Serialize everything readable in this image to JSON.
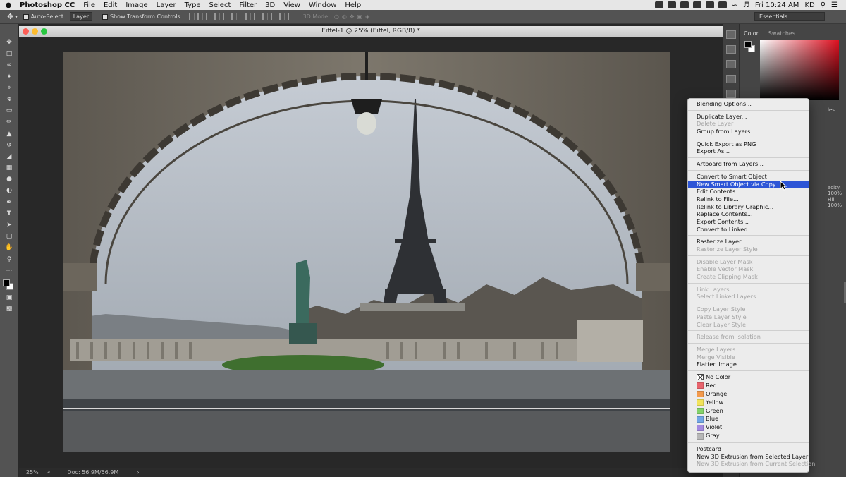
{
  "menubar": {
    "app_name": "Photoshop CC",
    "items": [
      "File",
      "Edit",
      "Image",
      "Layer",
      "Type",
      "Select",
      "Filter",
      "3D",
      "View",
      "Window",
      "Help"
    ],
    "clock": "Fri 10:24 AM",
    "user": "KD"
  },
  "options_bar": {
    "auto_select_label": "Auto-Select:",
    "auto_select_value": "Layer",
    "show_transform_label": "Show Transform Controls",
    "mode_3d_label": "3D Mode:",
    "workspace": "Essentials"
  },
  "document": {
    "title": "Eiffel-1 @ 25% (Eiffel, RGB/8) *"
  },
  "status_bar": {
    "zoom": "25%",
    "doc_size": "Doc: 56.9M/56.9M"
  },
  "panels": {
    "color_tab": "Color",
    "swatches_tab": "Swatches",
    "partial_les": "les",
    "partial_opacity": "acity: 100%",
    "partial_fill": "Fill: 100%"
  },
  "context_menu": {
    "groups": [
      [
        {
          "label": "Blending Options...",
          "disabled": false
        }
      ],
      [
        {
          "label": "Duplicate Layer...",
          "disabled": false
        },
        {
          "label": "Delete Layer",
          "disabled": true
        },
        {
          "label": "Group from Layers...",
          "disabled": false
        }
      ],
      [
        {
          "label": "Quick Export as PNG",
          "disabled": false
        },
        {
          "label": "Export As...",
          "disabled": false
        }
      ],
      [
        {
          "label": "Artboard from Layers...",
          "disabled": false
        }
      ],
      [
        {
          "label": "Convert to Smart Object",
          "disabled": false
        },
        {
          "label": "New Smart Object via Copy",
          "disabled": false,
          "highlighted": true
        },
        {
          "label": "Edit Contents",
          "disabled": false
        },
        {
          "label": "Relink to File...",
          "disabled": false
        },
        {
          "label": "Relink to Library Graphic...",
          "disabled": false
        },
        {
          "label": "Replace Contents...",
          "disabled": false
        },
        {
          "label": "Export Contents...",
          "disabled": false
        },
        {
          "label": "Convert to Linked...",
          "disabled": false
        }
      ],
      [
        {
          "label": "Rasterize Layer",
          "disabled": false
        },
        {
          "label": "Rasterize Layer Style",
          "disabled": true
        }
      ],
      [
        {
          "label": "Disable Layer Mask",
          "disabled": true
        },
        {
          "label": "Enable Vector Mask",
          "disabled": true
        },
        {
          "label": "Create Clipping Mask",
          "disabled": true
        }
      ],
      [
        {
          "label": "Link Layers",
          "disabled": true
        },
        {
          "label": "Select Linked Layers",
          "disabled": true
        }
      ],
      [
        {
          "label": "Copy Layer Style",
          "disabled": true
        },
        {
          "label": "Paste Layer Style",
          "disabled": true
        },
        {
          "label": "Clear Layer Style",
          "disabled": true
        }
      ],
      [
        {
          "label": "Release from Isolation",
          "disabled": true
        }
      ],
      [
        {
          "label": "Merge Layers",
          "disabled": true
        },
        {
          "label": "Merge Visible",
          "disabled": true
        },
        {
          "label": "Flatten Image",
          "disabled": false
        }
      ],
      "COLORS",
      [
        {
          "label": "Postcard",
          "disabled": false
        },
        {
          "label": "New 3D Extrusion from Selected Layer",
          "disabled": false
        },
        {
          "label": "New 3D Extrusion from Current Selection",
          "disabled": true
        }
      ]
    ],
    "colors": [
      {
        "label": "No Color",
        "hex": "none"
      },
      {
        "label": "Red",
        "hex": "#e8636c"
      },
      {
        "label": "Orange",
        "hex": "#f39a4c"
      },
      {
        "label": "Yellow",
        "hex": "#f2e35a"
      },
      {
        "label": "Green",
        "hex": "#84d36a"
      },
      {
        "label": "Blue",
        "hex": "#72a6e6"
      },
      {
        "label": "Violet",
        "hex": "#a48ae0"
      },
      {
        "label": "Gray",
        "hex": "#b7b7b7"
      }
    ]
  },
  "colors": {
    "menu_highlight": "#2d55d6",
    "ps_panel": "#535353"
  }
}
